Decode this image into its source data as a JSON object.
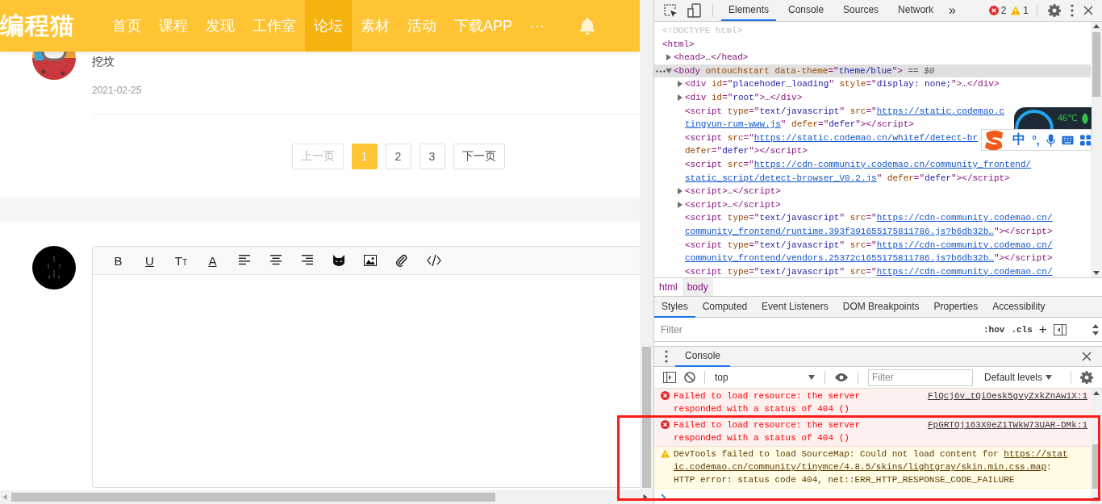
{
  "site": {
    "logo": "编程猫",
    "nav": [
      {
        "label": "首页",
        "selected": false
      },
      {
        "label": "课程",
        "selected": false
      },
      {
        "label": "发现",
        "selected": false
      },
      {
        "label": "工作室",
        "selected": false
      },
      {
        "label": "论坛",
        "selected": true
      },
      {
        "label": "素材",
        "selected": false
      },
      {
        "label": "活动",
        "selected": false
      },
      {
        "label": "下载APP",
        "selected": false
      },
      {
        "label": "···",
        "selected": false
      }
    ]
  },
  "post": {
    "text": "挖坟",
    "date": "2021-02-25"
  },
  "pagination": [
    {
      "label": "上一页",
      "disabled": true,
      "selected": false
    },
    {
      "label": "1",
      "disabled": false,
      "selected": true
    },
    {
      "label": "2",
      "disabled": false,
      "selected": false
    },
    {
      "label": "3",
      "disabled": false,
      "selected": false
    },
    {
      "label": "下一页",
      "disabled": false,
      "selected": false
    }
  ],
  "editor": {
    "tools": [
      {
        "kind": "char",
        "label": "B"
      },
      {
        "kind": "underline",
        "label": "U"
      },
      {
        "kind": "size",
        "label": "T",
        "small": "T"
      },
      {
        "kind": "underline",
        "label": "A"
      },
      {
        "kind": "align-left"
      },
      {
        "kind": "align-center"
      },
      {
        "kind": "align-right"
      },
      {
        "kind": "emoji"
      },
      {
        "kind": "image"
      },
      {
        "kind": "attach"
      },
      {
        "kind": "code"
      }
    ]
  },
  "devtools": {
    "tabs": [
      {
        "label": "Elements",
        "selected": true
      },
      {
        "label": "Console",
        "selected": false
      },
      {
        "label": "Sources",
        "selected": false
      },
      {
        "label": "Network",
        "selected": false
      }
    ],
    "more": "»",
    "errors": "2",
    "warnings": "1",
    "tree": [
      {
        "lines": [
          [
            {
              "kind": "doctype",
              "t": "<!DOCTYPE html>"
            }
          ]
        ]
      },
      {
        "lines": [
          [
            {
              "kind": "tag",
              "t": "<html>"
            }
          ]
        ],
        "children": [
          {
            "expanded": false,
            "lines": [
              [
                {
                  "kind": "tag",
                  "t": "<head>"
                },
                {
                  "kind": "text",
                  "t": "…"
                },
                {
                  "kind": "tag",
                  "t": "</head>"
                }
              ]
            ]
          },
          {
            "expanded": true,
            "selected": true,
            "lines": [
              [
                {
                  "kind": "tag",
                  "t": "<body "
                },
                {
                  "kind": "attr",
                  "t": "ontouchstart data-theme"
                },
                {
                  "kind": "tag",
                  "t": "=\""
                },
                {
                  "kind": "val",
                  "t": "theme/blue"
                },
                {
                  "kind": "tag",
                  "t": "\">"
                },
                {
                  "kind": "dim",
                  "t": " == $0"
                }
              ]
            ],
            "children": [
              {
                "expanded": false,
                "lines": [
                  [
                    {
                      "kind": "tag",
                      "t": "<div "
                    },
                    {
                      "kind": "attr",
                      "t": "id"
                    },
                    {
                      "kind": "tag",
                      "t": "=\""
                    },
                    {
                      "kind": "val",
                      "t": "placehoder_loading"
                    },
                    {
                      "kind": "tag",
                      "t": "\" "
                    },
                    {
                      "kind": "attr",
                      "t": "style"
                    },
                    {
                      "kind": "tag",
                      "t": "=\""
                    },
                    {
                      "kind": "val",
                      "t": "display: none;"
                    },
                    {
                      "kind": "tag",
                      "t": "\">"
                    },
                    {
                      "kind": "text",
                      "t": "…"
                    },
                    {
                      "kind": "tag",
                      "t": "</div>"
                    }
                  ]
                ]
              },
              {
                "expanded": false,
                "lines": [
                  [
                    {
                      "kind": "tag",
                      "t": "<div "
                    },
                    {
                      "kind": "attr",
                      "t": "id"
                    },
                    {
                      "kind": "tag",
                      "t": "=\""
                    },
                    {
                      "kind": "val",
                      "t": "root"
                    },
                    {
                      "kind": "tag",
                      "t": "\">"
                    },
                    {
                      "kind": "text",
                      "t": "…"
                    },
                    {
                      "kind": "tag",
                      "t": "</div>"
                    }
                  ]
                ]
              },
              {
                "lines": [
                  [
                    {
                      "kind": "tag",
                      "t": "<script "
                    },
                    {
                      "kind": "attr",
                      "t": "type"
                    },
                    {
                      "kind": "tag",
                      "t": "=\""
                    },
                    {
                      "kind": "val",
                      "t": "text/javascript"
                    },
                    {
                      "kind": "tag",
                      "t": "\" "
                    },
                    {
                      "kind": "attr",
                      "t": "src"
                    },
                    {
                      "kind": "tag",
                      "t": "=\""
                    },
                    {
                      "kind": "link",
                      "t": "https://static.codemao.c"
                    }
                  ],
                  [
                    {
                      "kind": "link",
                      "t": "tingyun-rum-www.js"
                    },
                    {
                      "kind": "tag",
                      "t": "\" "
                    },
                    {
                      "kind": "attr",
                      "t": "defer"
                    },
                    {
                      "kind": "tag",
                      "t": "=\""
                    },
                    {
                      "kind": "val",
                      "t": "defer"
                    },
                    {
                      "kind": "tag",
                      "t": "\"></script>"
                    }
                  ]
                ]
              },
              {
                "lines": [
                  [
                    {
                      "kind": "tag",
                      "t": "<script "
                    },
                    {
                      "kind": "attr",
                      "t": "src"
                    },
                    {
                      "kind": "tag",
                      "t": "=\""
                    },
                    {
                      "kind": "link",
                      "t": "https://static.codemao.cn/whitef/detect-br"
                    }
                  ],
                  [
                    {
                      "kind": "attr",
                      "t": "defer"
                    },
                    {
                      "kind": "tag",
                      "t": "=\""
                    },
                    {
                      "kind": "val",
                      "t": "defer"
                    },
                    {
                      "kind": "tag",
                      "t": "\"></script>"
                    }
                  ]
                ]
              },
              {
                "lines": [
                  [
                    {
                      "kind": "tag",
                      "t": "<script "
                    },
                    {
                      "kind": "attr",
                      "t": "src"
                    },
                    {
                      "kind": "tag",
                      "t": "=\""
                    },
                    {
                      "kind": "link",
                      "t": "https://cdn-community.codemao.cn/community_frontend/"
                    }
                  ],
                  [
                    {
                      "kind": "link",
                      "t": "static_script/detect-browser_V0.2.js"
                    },
                    {
                      "kind": "tag",
                      "t": "\" "
                    },
                    {
                      "kind": "attr",
                      "t": "defer"
                    },
                    {
                      "kind": "tag",
                      "t": "=\""
                    },
                    {
                      "kind": "val",
                      "t": "defer"
                    },
                    {
                      "kind": "tag",
                      "t": "\"></script>"
                    }
                  ]
                ]
              },
              {
                "expanded": false,
                "lines": [
                  [
                    {
                      "kind": "tag",
                      "t": "<script>"
                    },
                    {
                      "kind": "text",
                      "t": "…"
                    },
                    {
                      "kind": "tag",
                      "t": "</script>"
                    }
                  ]
                ]
              },
              {
                "expanded": false,
                "lines": [
                  [
                    {
                      "kind": "tag",
                      "t": "<script>"
                    },
                    {
                      "kind": "text",
                      "t": "…"
                    },
                    {
                      "kind": "tag",
                      "t": "</script>"
                    }
                  ]
                ]
              },
              {
                "lines": [
                  [
                    {
                      "kind": "tag",
                      "t": "<script "
                    },
                    {
                      "kind": "attr",
                      "t": "type"
                    },
                    {
                      "kind": "tag",
                      "t": "=\""
                    },
                    {
                      "kind": "val",
                      "t": "text/javascript"
                    },
                    {
                      "kind": "tag",
                      "t": "\" "
                    },
                    {
                      "kind": "attr",
                      "t": "src"
                    },
                    {
                      "kind": "tag",
                      "t": "=\""
                    },
                    {
                      "kind": "link",
                      "t": "https://cdn-community.codemao.cn/"
                    }
                  ],
                  [
                    {
                      "kind": "link",
                      "t": "community_frontend/runtime.393f391655175811786.js?b6db32b…"
                    },
                    {
                      "kind": "tag",
                      "t": "\"></script>"
                    }
                  ]
                ]
              },
              {
                "lines": [
                  [
                    {
                      "kind": "tag",
                      "t": "<script "
                    },
                    {
                      "kind": "attr",
                      "t": "type"
                    },
                    {
                      "kind": "tag",
                      "t": "=\""
                    },
                    {
                      "kind": "val",
                      "t": "text/javascript"
                    },
                    {
                      "kind": "tag",
                      "t": "\" "
                    },
                    {
                      "kind": "attr",
                      "t": "src"
                    },
                    {
                      "kind": "tag",
                      "t": "=\""
                    },
                    {
                      "kind": "link",
                      "t": "https://cdn-community.codemao.cn/"
                    }
                  ],
                  [
                    {
                      "kind": "link",
                      "t": "community_frontend/vendors.25372c1655175811786.js?b6db32b…"
                    },
                    {
                      "kind": "tag",
                      "t": "\"></script>"
                    }
                  ]
                ]
              },
              {
                "lines": [
                  [
                    {
                      "kind": "tag",
                      "t": "<script "
                    },
                    {
                      "kind": "attr",
                      "t": "type"
                    },
                    {
                      "kind": "tag",
                      "t": "=\""
                    },
                    {
                      "kind": "val",
                      "t": "text/javascript"
                    },
                    {
                      "kind": "tag",
                      "t": "\" "
                    },
                    {
                      "kind": "attr",
                      "t": "src"
                    },
                    {
                      "kind": "tag",
                      "t": "=\""
                    },
                    {
                      "kind": "link",
                      "t": "https://cdn-community.codemao.cn/"
                    }
                  ]
                ]
              }
            ]
          }
        ]
      }
    ],
    "breadcrumbs": [
      {
        "label": "html",
        "selected": false
      },
      {
        "label": "body",
        "selected": true
      }
    ],
    "sidebar_tabs": [
      {
        "label": "Styles",
        "selected": true
      },
      {
        "label": "Computed",
        "selected": false
      },
      {
        "label": "Event Listeners",
        "selected": false
      },
      {
        "label": "DOM Breakpoints",
        "selected": false
      },
      {
        "label": "Properties",
        "selected": false
      },
      {
        "label": "Accessibility",
        "selected": false
      }
    ],
    "styles_filter": {
      "placeholder": "Filter"
    },
    "hov": ":hov",
    "cls": ".cls",
    "add": "+",
    "drawer": {
      "tab": {
        "label": "Console",
        "selected": true
      }
    },
    "console": {
      "context": "top",
      "filter": {
        "placeholder": "Filter"
      },
      "levels": "Default levels",
      "messages": [
        {
          "kind": "error",
          "lines": [
            [
              {
                "kind": "text",
                "t": "Failed to load resource: the server responded with a status of 404 ()"
              }
            ]
          ],
          "source": "FlQcj6v_tQiOesk5gvyZxkZnAw1X:1"
        },
        {
          "kind": "error",
          "lines": [
            [
              {
                "kind": "text",
                "t": "Failed to load resource: the server responded with a status of 404 ()"
              }
            ]
          ],
          "source": "FpGRTOj163X0eZ1TWkW73UAR-DMk:1"
        },
        {
          "kind": "warning",
          "lines": [
            [
              {
                "kind": "text",
                "t": "DevTools failed to load SourceMap: Could not load content for "
              },
              {
                "kind": "link",
                "t": "https://stat"
              }
            ],
            [
              {
                "kind": "link",
                "t": "ic.codemao.cn/community/tinymce/4.8.5/skins/lightgray/skin.min.css.map"
              },
              {
                "kind": "text",
                "t": ":"
              }
            ],
            [
              {
                "kind": "text",
                "t": "HTTP error: status code 404, net::ERR_HTTP_RESPONSE_CODE_FAILURE"
              }
            ]
          ]
        }
      ]
    }
  },
  "overlays": {
    "monitor": {
      "temperature": "46℃"
    },
    "ime": {
      "mode": "中",
      "punct": "°,"
    }
  }
}
